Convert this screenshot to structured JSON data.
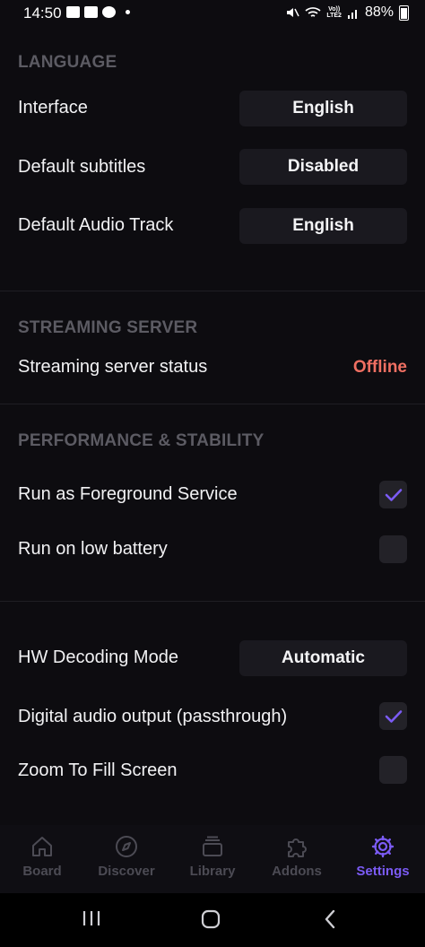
{
  "status_bar": {
    "time": "14:50",
    "network": "Vo))\nLTE2",
    "battery": "88%"
  },
  "sections": {
    "language": {
      "title": "LANGUAGE",
      "interface": {
        "label": "Interface",
        "value": "English"
      },
      "subtitles": {
        "label": "Default subtitles",
        "value": "Disabled"
      },
      "audio": {
        "label": "Default Audio Track",
        "value": "English"
      }
    },
    "streaming": {
      "title": "STREAMING SERVER",
      "status": {
        "label": "Streaming server status",
        "value": "Offline"
      }
    },
    "performance": {
      "title": "PERFORMANCE & STABILITY",
      "foreground": {
        "label": "Run as Foreground Service",
        "checked": true
      },
      "low_battery": {
        "label": "Run on low battery",
        "checked": false
      }
    },
    "player": {
      "hw_decoding": {
        "label": "HW Decoding Mode",
        "value": "Automatic"
      },
      "digital_audio": {
        "label": "Digital audio output (passthrough)",
        "checked": true
      },
      "zoom_fill": {
        "label": "Zoom To Fill Screen",
        "checked": false
      }
    }
  },
  "bottom_nav": {
    "items": [
      {
        "label": "Board",
        "icon": "home-icon",
        "active": false
      },
      {
        "label": "Discover",
        "icon": "compass-icon",
        "active": false
      },
      {
        "label": "Library",
        "icon": "library-icon",
        "active": false
      },
      {
        "label": "Addons",
        "icon": "puzzle-icon",
        "active": false
      },
      {
        "label": "Settings",
        "icon": "gear-icon",
        "active": true
      }
    ]
  },
  "colors": {
    "accent": "#7b5bf5",
    "offline": "#ef6f62",
    "background": "#0d0c10"
  }
}
